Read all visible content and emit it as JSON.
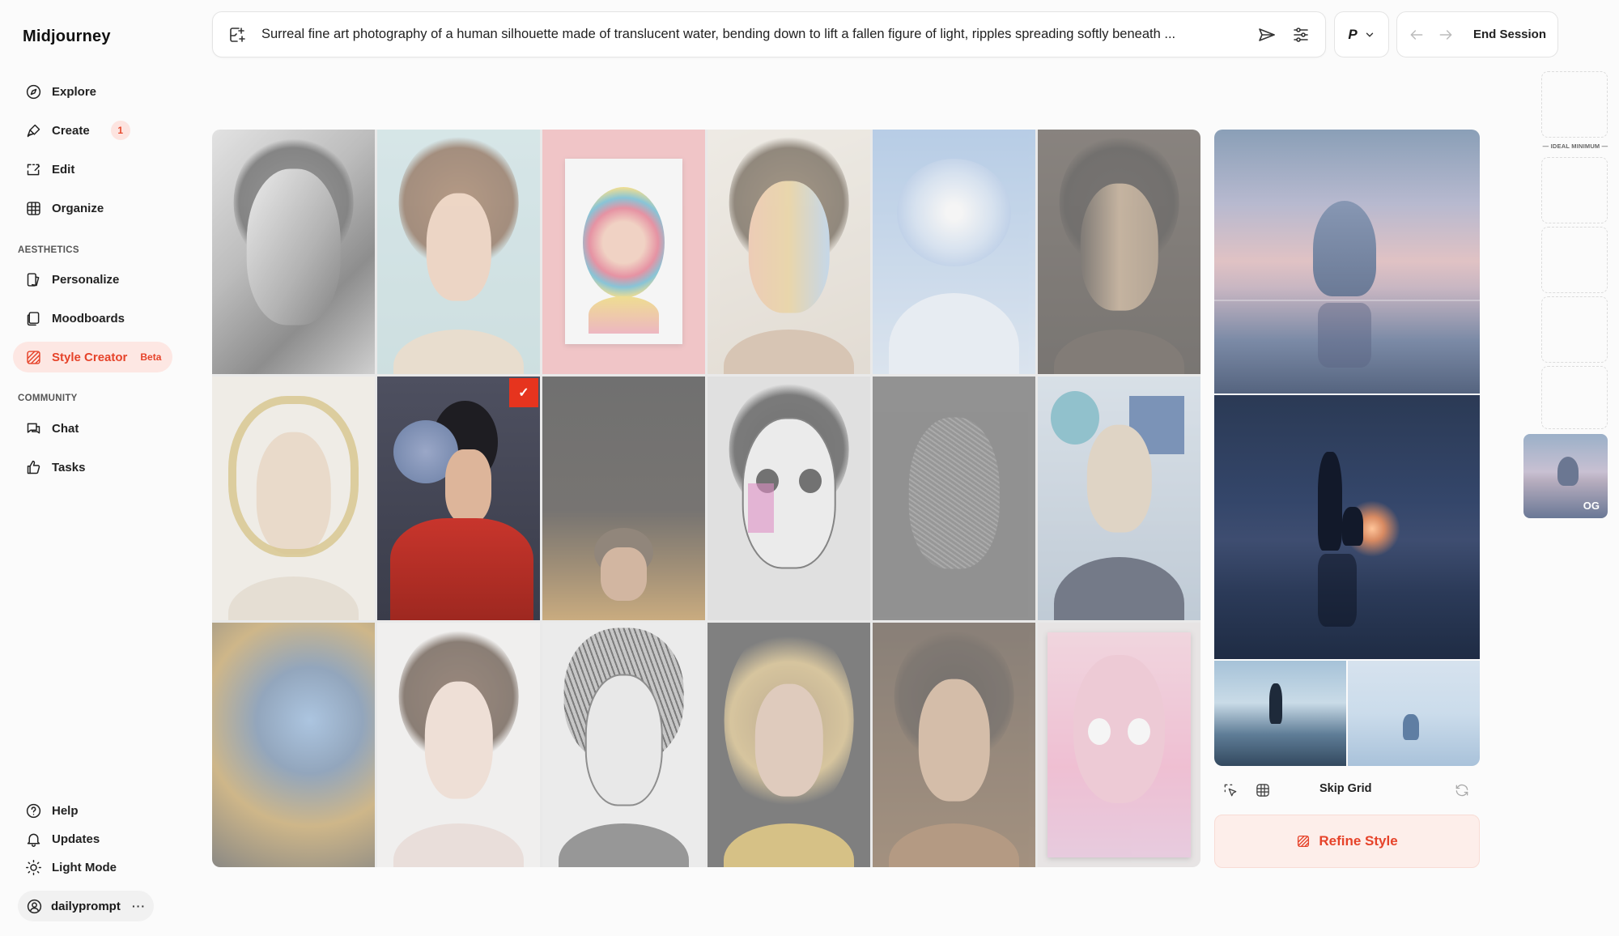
{
  "app": {
    "title": "Midjourney"
  },
  "sidebar": {
    "items": [
      {
        "label": "Explore",
        "icon": "compass-icon"
      },
      {
        "label": "Create",
        "icon": "brush-icon",
        "badge": "1"
      },
      {
        "label": "Edit",
        "icon": "edit-icon"
      },
      {
        "label": "Organize",
        "icon": "grid-icon"
      }
    ],
    "aesthetics_label": "AESTHETICS",
    "aesthetics_items": [
      {
        "label": "Personalize",
        "icon": "personalize-icon"
      },
      {
        "label": "Moodboards",
        "icon": "moodboard-icon"
      },
      {
        "label": "Style Creator",
        "icon": "style-icon",
        "tag": "Beta"
      }
    ],
    "community_label": "COMMUNITY",
    "community_items": [
      {
        "label": "Chat",
        "icon": "chat-icon"
      },
      {
        "label": "Tasks",
        "icon": "thumbs-up-icon"
      }
    ],
    "bottom_items": [
      {
        "label": "Help",
        "icon": "help-icon"
      },
      {
        "label": "Updates",
        "icon": "bell-icon"
      },
      {
        "label": "Light Mode",
        "icon": "sun-icon"
      }
    ],
    "user": {
      "name": "dailyprompt",
      "more": "···"
    }
  },
  "prompt": {
    "text": "Surreal fine art photography of a human silhouette made of translucent water, bending down to lift a fallen figure of light, ripples spreading softly beneath ..."
  },
  "param": {
    "label": "P"
  },
  "session": {
    "end_label": "End Session"
  },
  "grid": {
    "selected_index": 7,
    "check_glyph": "✓"
  },
  "preview": {
    "skip_label": "Skip Grid",
    "refine_label": "Refine Style"
  },
  "side": {
    "ideal_label": "— IDEAL MINIMUM —",
    "og_label": "OG"
  },
  "colors": {
    "accent": "#e6432a",
    "accent_bg": "#fde7e3"
  }
}
